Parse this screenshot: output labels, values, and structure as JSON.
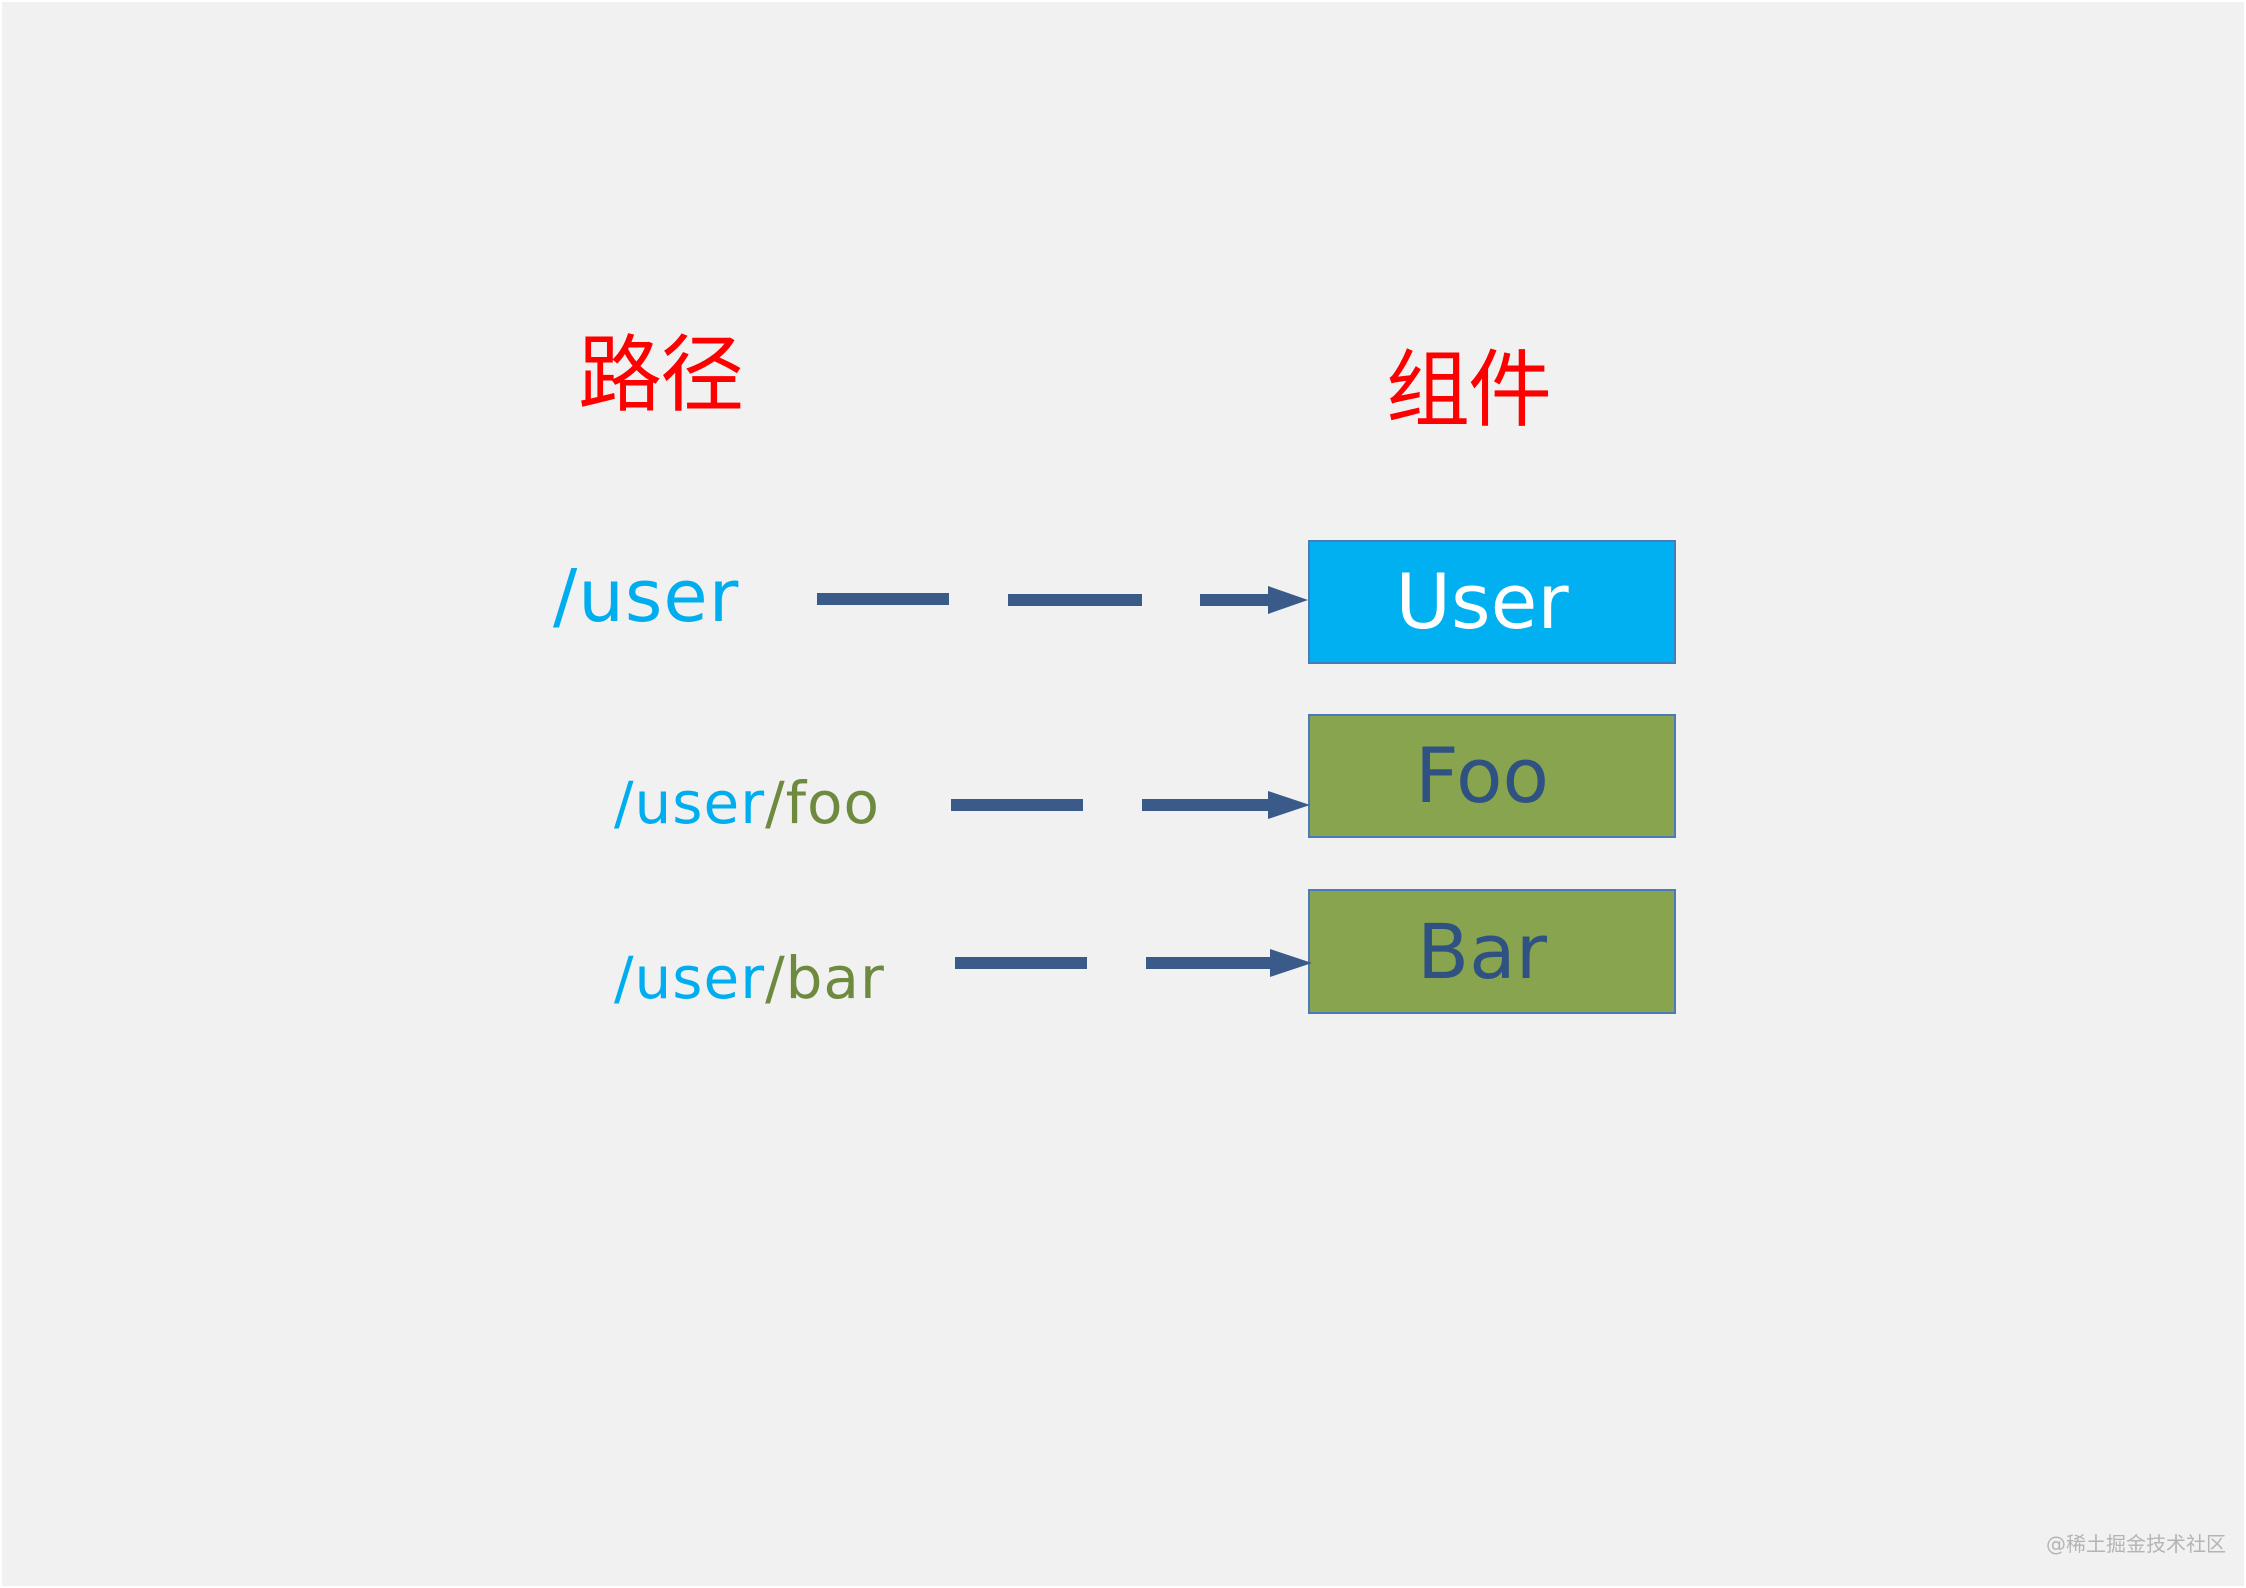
{
  "headings": {
    "path": "路径",
    "component": "组件"
  },
  "routes": [
    {
      "segments": [
        {
          "text": "/user",
          "role": "parent"
        }
      ],
      "component": "User",
      "component_color": "#00b0f0",
      "component_text_color": "#ffffff",
      "connector": "dashed-arrow"
    },
    {
      "segments": [
        {
          "text": "/user",
          "role": "parent"
        },
        {
          "text": "/foo",
          "role": "child"
        }
      ],
      "component": "Foo",
      "component_color": "#88a44e",
      "component_text_color": "#2f5283",
      "connector": "dashed-arrow"
    },
    {
      "segments": [
        {
          "text": "/user",
          "role": "parent"
        },
        {
          "text": "/bar",
          "role": "child"
        }
      ],
      "component": "Bar",
      "component_color": "#88a44e",
      "component_text_color": "#2f5283",
      "connector": "dashed-arrow"
    }
  ],
  "colors": {
    "heading": "#ff0000",
    "parent_segment": "#00aeef",
    "child_segment": "#6e8a3f",
    "arrow": "#3a5a8a",
    "background": "#f1f1f1"
  },
  "watermark": "@稀土掘金技术社区"
}
